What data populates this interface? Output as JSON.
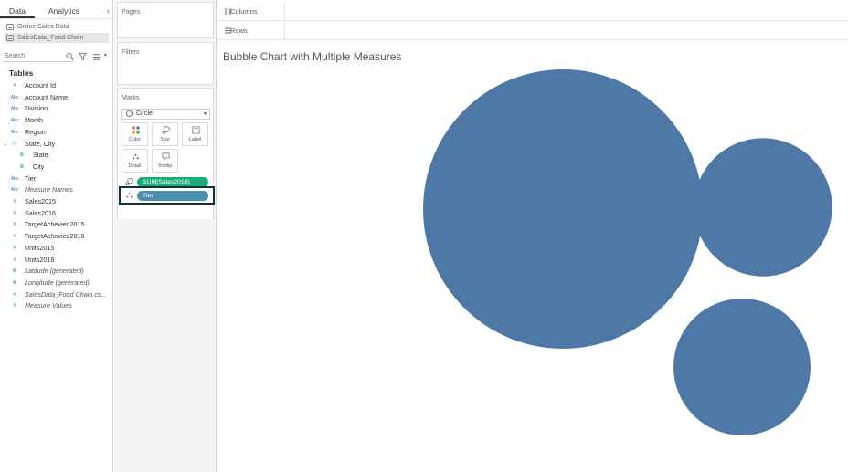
{
  "data_pane": {
    "tabs": [
      "Data",
      "Analytics"
    ],
    "collapse_glyph": "‹",
    "datasources": [
      "Online Sales Data",
      "SalesData_Food Chain"
    ],
    "search_placeholder": "Search",
    "tables_heading": "Tables",
    "fields": [
      {
        "type": "#",
        "name": "Account Id"
      },
      {
        "type": "Abc",
        "name": "Account Name"
      },
      {
        "type": "Abc",
        "name": "Division"
      },
      {
        "type": "Abc",
        "name": "Month"
      },
      {
        "type": "Abc",
        "name": "Region"
      },
      {
        "type": "geo-hierarchy",
        "name": "State, City",
        "expanded": true
      },
      {
        "type": "globe",
        "name": "State",
        "indent": true
      },
      {
        "type": "globe",
        "name": "City",
        "indent": true
      },
      {
        "type": "Abc",
        "name": "Tier"
      },
      {
        "type": "Abc",
        "name": "Measure Names",
        "italic": true
      },
      {
        "type": "#",
        "name": "Sales2015"
      },
      {
        "type": "#",
        "name": "Sales2016"
      },
      {
        "type": "#",
        "name": "TargetAchevied2015"
      },
      {
        "type": "#",
        "name": "TargetAchevied2016"
      },
      {
        "type": "#",
        "name": "Units2015"
      },
      {
        "type": "#",
        "name": "Units2016"
      },
      {
        "type": "globe",
        "name": "Latitude (generated)",
        "italic": true
      },
      {
        "type": "globe",
        "name": "Longitude (generated)",
        "italic": true
      },
      {
        "type": "#",
        "name": "SalesData_Food Chain.cs...",
        "italic": true
      },
      {
        "type": "#",
        "name": "Measure Values",
        "italic": true
      }
    ]
  },
  "shelves": {
    "pages_title": "Pages",
    "filters_title": "Filters",
    "marks_title": "Marks",
    "mark_type": "Circle",
    "buttons": {
      "color": "Color",
      "size": "Size",
      "label": "Label",
      "detail": "Detail",
      "tooltip": "Tooltip"
    },
    "pills": {
      "size_pill": "SUM(Sales2016)",
      "detail_pill": "Tier"
    }
  },
  "columns_label": "Columns",
  "rows_label": "Rows",
  "view": {
    "title": "Bubble Chart with Multiple Measures",
    "bubble_color": "#4e79a7"
  },
  "chart_data": {
    "type": "scatter",
    "title": "Bubble Chart with Multiple Measures",
    "encoding": "packed bubbles: size = SUM(Sales2016), detail = Tier",
    "series": [
      {
        "label": "bubble-1",
        "relative_size": 1.0
      },
      {
        "label": "bubble-2",
        "relative_size": 0.495
      },
      {
        "label": "bubble-3",
        "relative_size": 0.49
      }
    ],
    "colors": [
      "#4e79a7"
    ]
  }
}
